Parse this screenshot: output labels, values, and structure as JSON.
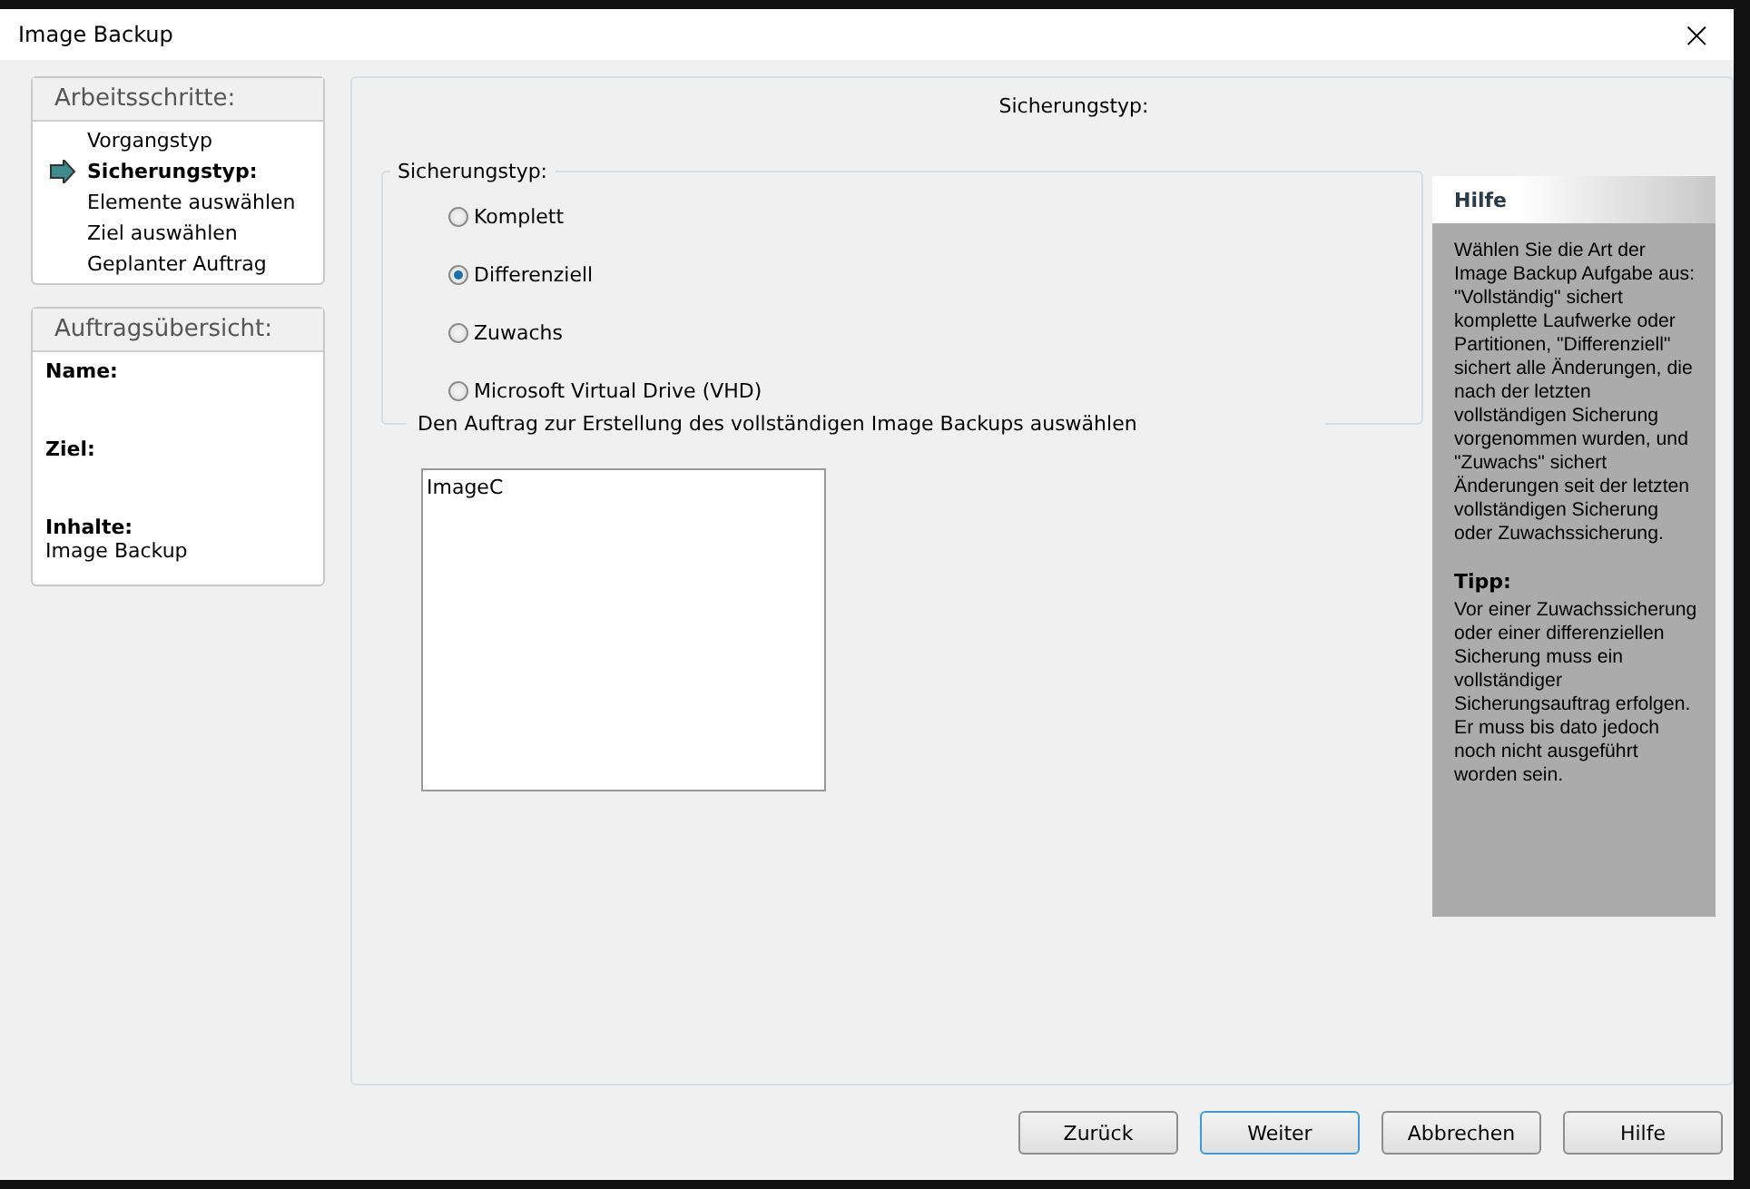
{
  "window": {
    "title": "Image Backup",
    "close": "×"
  },
  "steps": {
    "heading": "Arbeitsschritte:",
    "items": [
      {
        "label": "Vorgangstyp",
        "selected": false
      },
      {
        "label": "Sicherungstyp:",
        "selected": true
      },
      {
        "label": "Elemente auswählen",
        "selected": false
      },
      {
        "label": "Ziel auswählen",
        "selected": false
      },
      {
        "label": "Geplanter Auftrag",
        "selected": false
      }
    ]
  },
  "summary": {
    "heading": "Auftragsübersicht:",
    "fields": [
      {
        "label": "Name:"
      },
      {
        "label": "Ziel:"
      },
      {
        "label": "Inhalte:",
        "value": "Image Backup"
      }
    ]
  },
  "main": {
    "title": "Sicherungstyp:",
    "group": {
      "legend": "Sicherungstyp:",
      "options": [
        {
          "label": "Komplett",
          "selected": false
        },
        {
          "label": "Differenziell",
          "selected": true
        },
        {
          "label": "Zuwachs",
          "selected": false
        },
        {
          "label": "Microsoft Virtual Drive (VHD)",
          "selected": false
        }
      ]
    },
    "list_label": "Den Auftrag zur Erstellung des vollständigen Image Backups auswählen",
    "list_items": [
      "ImageC"
    ]
  },
  "help": {
    "title": "Hilfe",
    "text": "Wählen Sie die Art der Image Backup Aufgabe aus: \"Vollständig\" sichert komplette Laufwerke oder Partitionen, \"Differenziell\" sichert alle Änderungen, die nach der letzten vollständigen Sicherung vorgenommen wurden, und \"Zuwachs\" sichert Änderungen seit der letzten vollständigen Sicherung oder Zuwachssicherung.",
    "tip_title": "Tipp:",
    "tip": "Vor einer Zuwachssicherung oder einer differenziellen Sicherung muss ein vollständiger Sicherungsauftrag erfolgen. Er muss bis dato jedoch noch nicht ausgeführt worden sein."
  },
  "buttons": [
    {
      "label": "Zurück",
      "default": false
    },
    {
      "label": "Weiter",
      "default": true
    },
    {
      "label": "Abbrechen",
      "default": false
    },
    {
      "label": "Hilfe",
      "default": false
    }
  ]
}
